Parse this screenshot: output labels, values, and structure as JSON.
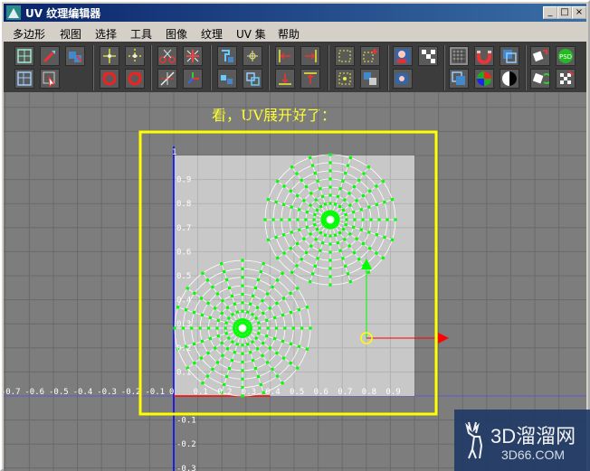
{
  "window": {
    "title": "UV 纹理编辑器",
    "controls": {
      "minimize": "_",
      "maximize": "□",
      "close": "×"
    }
  },
  "menu": [
    "多边形",
    "视图",
    "选择",
    "工具",
    "图像",
    "纹理",
    "UV 集",
    "帮助"
  ],
  "toolbar": {
    "psd_label": "PSD"
  },
  "editor": {
    "caption": "看，UV展开好了：",
    "top_value": "1",
    "y_ticks": [
      "0.9",
      "0.8",
      "0.7",
      "0.6",
      "0.5",
      "0.4",
      "0.3",
      "0.2",
      "0.1",
      "-0.1",
      "-0.2",
      "-0.3"
    ],
    "x_ticks_neg": [
      "-0.7",
      "-0.6",
      "-0.5",
      "-0.4",
      "-0.3",
      "-0.2",
      "-0.1",
      "0"
    ],
    "x_ticks_pos": [
      "0.1",
      "0.2",
      "0.3",
      "0.4",
      "0.5",
      "0.6",
      "0.7",
      "0.8",
      "0.9"
    ],
    "colors": {
      "grid_bg": "#7d7d7d",
      "uv_square": "#c8c8c8",
      "uv_points": "#00ff00",
      "highlight_box": "#ffff00",
      "axis_y": "#0000ff",
      "axis_x": "#ff0000",
      "caption": "#ffff33"
    }
  },
  "watermark": {
    "line1": "3D溜溜网",
    "line2": "3D66.COM"
  }
}
